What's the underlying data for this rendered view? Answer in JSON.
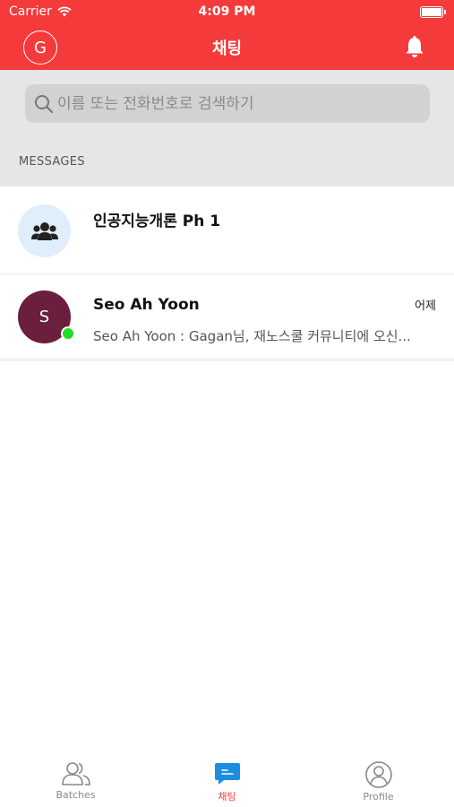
{
  "status_bar": {
    "carrier": "Carrier",
    "time": "4:09 PM"
  },
  "header": {
    "avatar_initial": "G",
    "title": "채팅",
    "bell_icon": "bell-icon"
  },
  "search": {
    "placeholder": "이름 또는 전화번호로 검색하기"
  },
  "section_label": "MESSAGES",
  "conversations": [
    {
      "title": "인공지능개론 Ph 1",
      "icon": "group-icon"
    },
    {
      "avatar_initial": "S",
      "title": "Seo Ah Yoon",
      "time": "어제",
      "preview": "Seo Ah Yoon : Gagan님, 재노스쿨 커뮤니티에 오신...",
      "online": true
    }
  ],
  "tabs": [
    {
      "label": "Batches",
      "icon": "people-icon"
    },
    {
      "label": "채팅",
      "icon": "chat-icon",
      "active": true
    },
    {
      "label": "Profile",
      "icon": "profile-icon"
    }
  ],
  "colors": {
    "accent": "#f43a3a",
    "online": "#22dd22",
    "chat_tab": "#1a8fe0",
    "avatar_bg": "#6b1e3e",
    "group_avatar_bg": "#dfeefa"
  }
}
